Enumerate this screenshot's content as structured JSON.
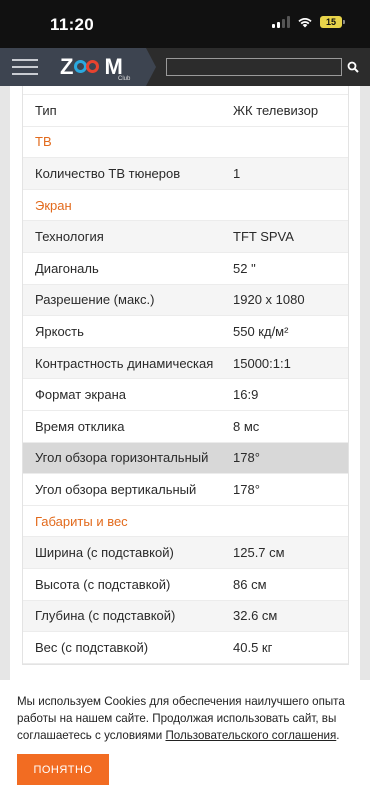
{
  "status_bar": {
    "time": "11:20",
    "battery": "15"
  },
  "header": {
    "logo_left": "Z",
    "logo_right": "M",
    "logo_sub": "Club",
    "search_placeholder": ""
  },
  "specs": [
    {
      "type": "row",
      "key": "Тип",
      "value": "ЖК телевизор",
      "style": ""
    },
    {
      "type": "section",
      "key": "ТВ"
    },
    {
      "type": "row",
      "key": "Количество ТВ тюнеров",
      "value": "1",
      "style": "stripe"
    },
    {
      "type": "section",
      "key": "Экран"
    },
    {
      "type": "row",
      "key": "Технология",
      "value": "TFT SPVA",
      "style": "stripe"
    },
    {
      "type": "row",
      "key": "Диагональ",
      "value": "52 \"",
      "style": ""
    },
    {
      "type": "row",
      "key": "Разрешение (макс.)",
      "value": "1920 x 1080",
      "style": "stripe"
    },
    {
      "type": "row",
      "key": "Яркость",
      "value": "550 кд/м²",
      "style": ""
    },
    {
      "type": "row",
      "key": "Контрастность динамическая",
      "value": "15000:1:1",
      "style": "stripe"
    },
    {
      "type": "row",
      "key": "Формат экрана",
      "value": "16:9",
      "style": ""
    },
    {
      "type": "row",
      "key": "Время отклика",
      "value": "8 мс",
      "style": ""
    },
    {
      "type": "row",
      "key": "Угол обзора горизонтальный",
      "value": "178°",
      "style": "hl"
    },
    {
      "type": "row",
      "key": "Угол обзора вертикальный",
      "value": "178°",
      "style": ""
    },
    {
      "type": "section",
      "key": "Габариты и вес"
    },
    {
      "type": "row",
      "key": "Ширина (с подставкой)",
      "value": "125.7 см",
      "style": "stripe"
    },
    {
      "type": "row",
      "key": "Высота (с подставкой)",
      "value": "86 см",
      "style": ""
    },
    {
      "type": "row",
      "key": "Глубина (с подставкой)",
      "value": "32.6 см",
      "style": "stripe"
    },
    {
      "type": "row",
      "key": "Вес (с подставкой)",
      "value": "40.5 кг",
      "style": ""
    }
  ],
  "cookie": {
    "text_before": "Мы используем Cookies для обеспечения наилучшего опыта работы на нашем сайте. Продолжая использовать сайт, вы соглашаетесь с условиями ",
    "link": "Пользовательского соглашения",
    "text_after": ".",
    "button": "ПОНЯТНО"
  },
  "colors": {
    "accent": "#f26c22",
    "section": "#e26a1c",
    "header": "#2c2c2c"
  }
}
